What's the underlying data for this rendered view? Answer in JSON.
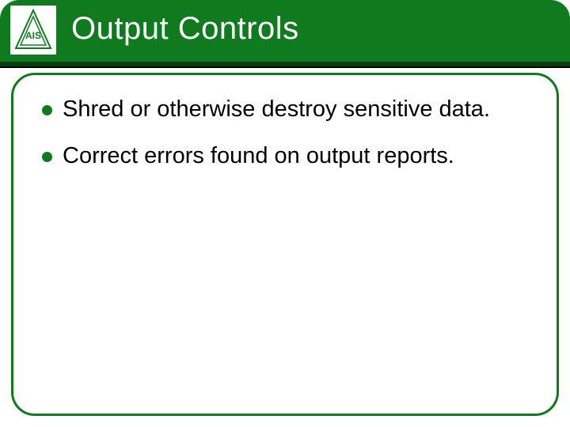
{
  "header": {
    "title": "Output Controls",
    "logo_alt": "AIS Systems logo"
  },
  "bullets": [
    "Shred or otherwise destroy sensitive data.",
    "Correct errors found on output reports."
  ],
  "colors": {
    "brand_green": "#0f7a1e",
    "dark_green": "#083d0e"
  }
}
